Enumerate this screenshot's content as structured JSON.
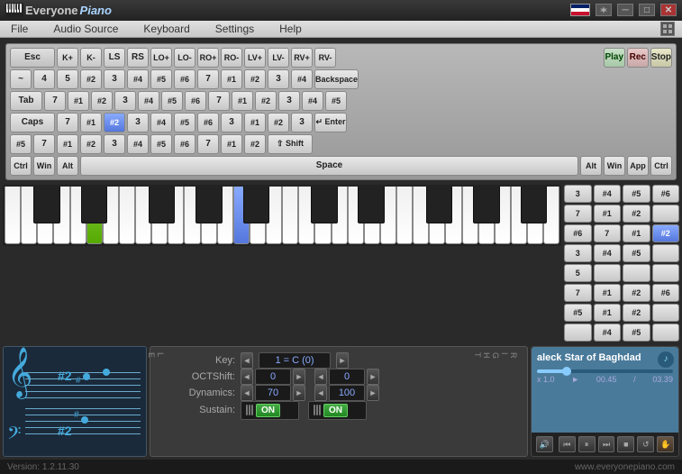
{
  "app": {
    "title": "Everyone",
    "title2": "Piano",
    "version": "Version: 1.2.11.30",
    "website": "www.everyonepiano.com"
  },
  "menu": {
    "items": [
      "File",
      "Audio Source",
      "Keyboard",
      "Settings",
      "Help"
    ]
  },
  "toolbar": {
    "esc": "Esc",
    "kplus": "K+",
    "kminus": "K-",
    "ls": "LS",
    "rs": "RS",
    "lo_plus": "LO+",
    "lo_minus": "LO-",
    "ro_plus": "RO+",
    "ro_minus": "RO-",
    "lv_plus": "LV+",
    "lv_minus": "LV-",
    "rv_plus": "RV+",
    "rv_minus": "RV-",
    "play": "Play",
    "rec": "Rec",
    "stop": "Stop"
  },
  "keyboard_rows": {
    "row1": [
      "~",
      "4",
      "5",
      "#2",
      "3",
      "#4",
      "#5",
      "#6",
      "7",
      "#1",
      "#2",
      "3",
      "#4"
    ],
    "row2": [
      "Tab",
      "7",
      "#1",
      "#2",
      "3",
      "#4",
      "#5",
      "#6",
      "7",
      "#1",
      "#2",
      "3",
      "#4",
      "#5"
    ],
    "row3": [
      "Caps",
      "7",
      "#1",
      "#2",
      "3",
      "#4",
      "#5",
      "#6",
      "3",
      "#1",
      "#2",
      "3"
    ],
    "row4": [
      "#5",
      "7",
      "#1",
      "#2",
      "3",
      "#4",
      "#5",
      "#6",
      "7",
      "#1",
      "#2"
    ],
    "row5": [
      "Ctrl",
      "Win",
      "Alt",
      "Space",
      "Alt",
      "Win",
      "App",
      "Ctrl"
    ]
  },
  "right_numpad": {
    "rows": [
      [
        "3",
        "#4",
        "#5",
        "#6"
      ],
      [
        "7",
        "#1",
        "#2",
        ""
      ],
      [
        "#6",
        "7",
        "#1",
        ""
      ],
      [
        "3",
        "#4",
        "#5",
        ""
      ],
      [
        "5",
        "",
        "",
        ""
      ],
      [
        "7",
        "#1",
        "#2",
        "#6"
      ],
      [
        "#5",
        "#1",
        "#2",
        ""
      ],
      [
        "",
        "#4",
        "#5",
        ""
      ]
    ]
  },
  "controls": {
    "key_label": "Key:",
    "key_value": "1 = C (0)",
    "oct_label": "OCTShift:",
    "oct_val1": "0",
    "oct_val2": "0",
    "dynamics_label": "Dynamics:",
    "dynamics_val1": "70",
    "dynamics_val2": "100",
    "sustain_label": "Sustain:",
    "sustain_val": "ON",
    "sustain_val2": "ON",
    "left_label": "L",
    "left_label2": "E",
    "left_label3": "F",
    "left_label4": "T",
    "right_label": "R",
    "right_label2": "I",
    "right_label3": "G",
    "right_label4": "H",
    "right_label5": "T"
  },
  "media": {
    "title": "aleck Star of Baghdad",
    "time_current": "00.45",
    "time_total": "03.39",
    "speed": "x 1.0",
    "progress_pct": 22
  },
  "notes": {
    "sharp1": "#2",
    "sharp2": "#2",
    "sharp3": "#",
    "number": "#2"
  }
}
